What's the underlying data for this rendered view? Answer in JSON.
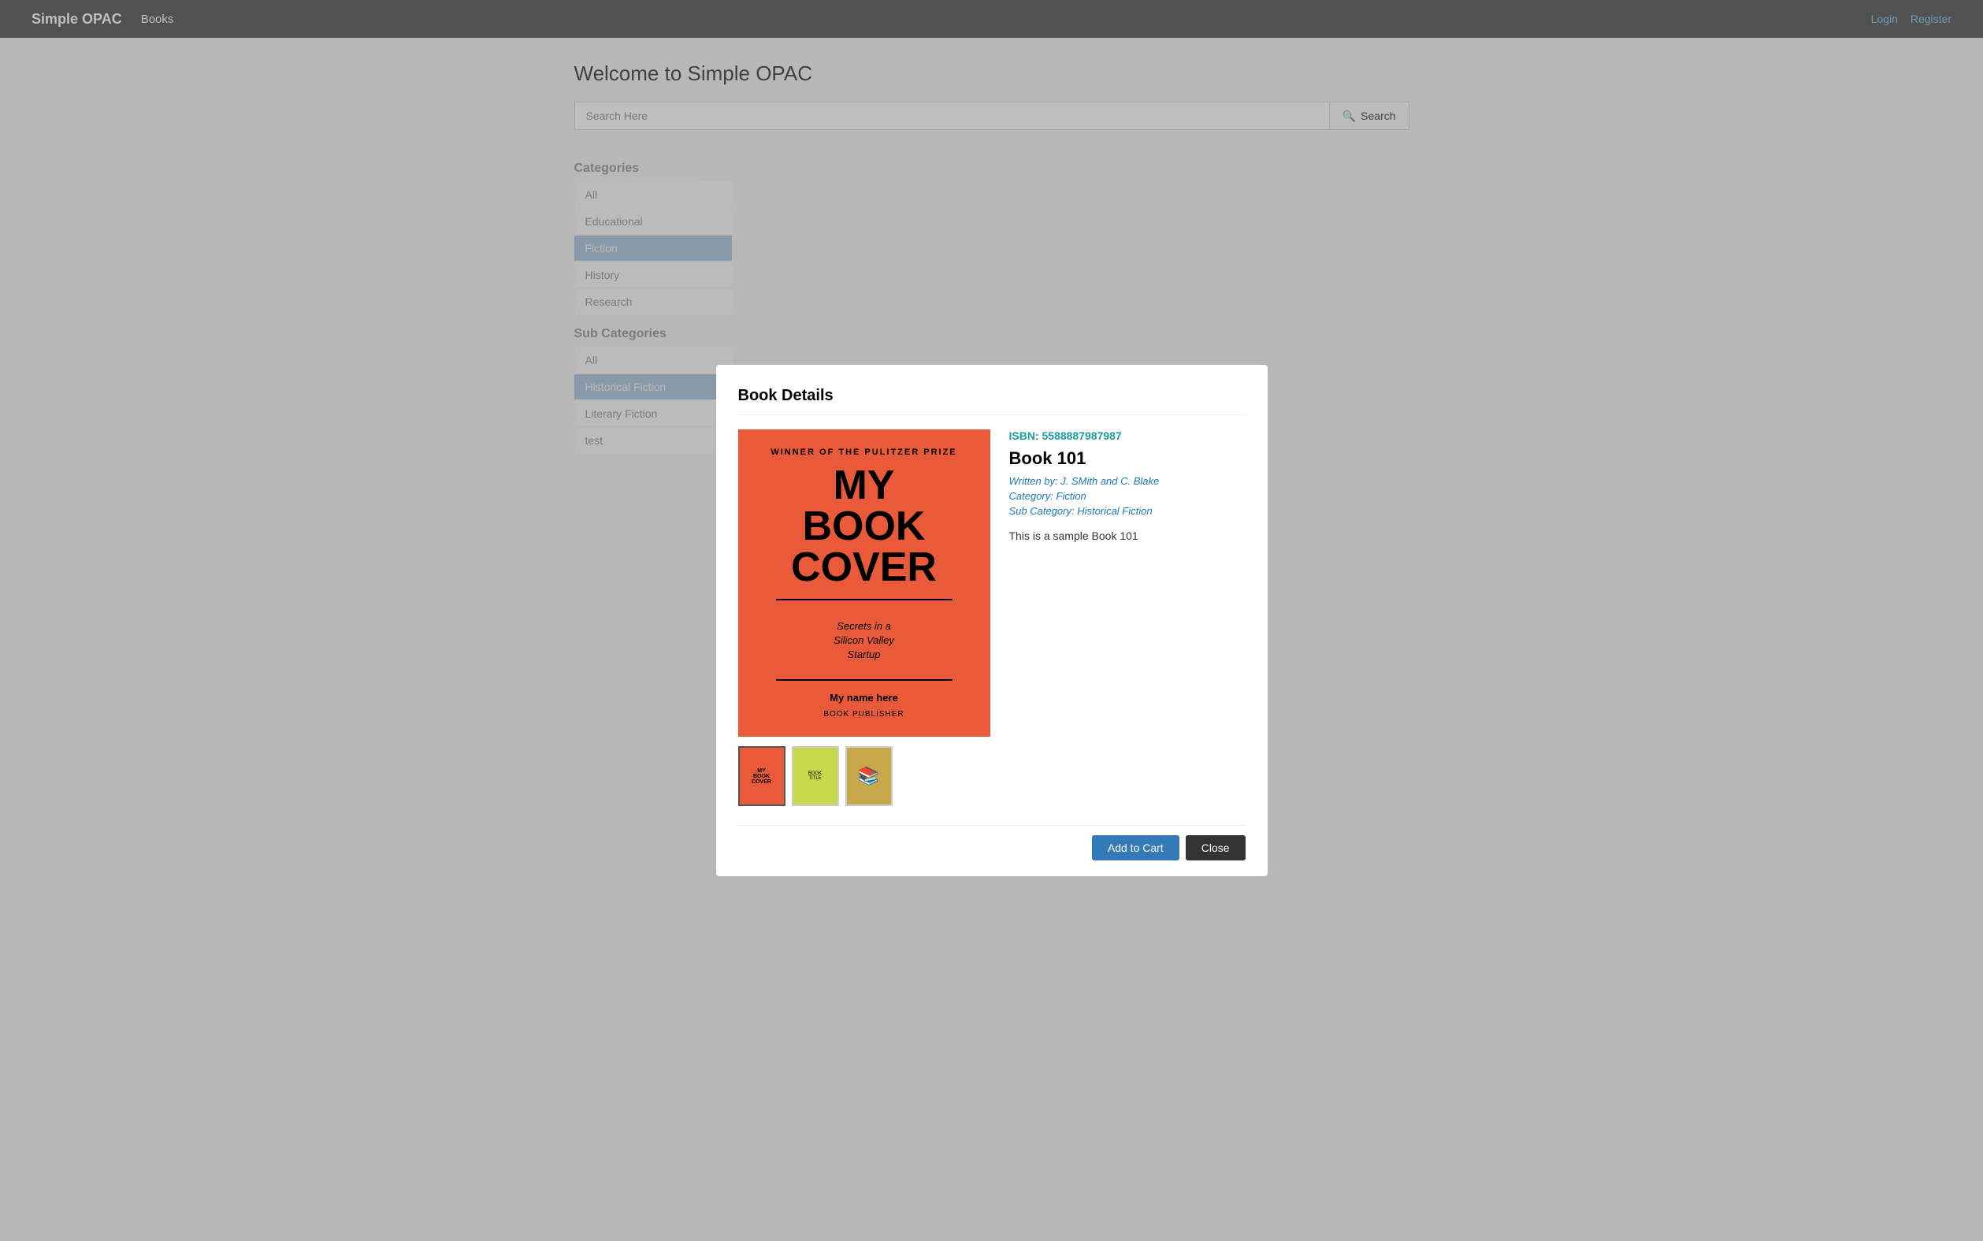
{
  "navbar": {
    "brand": "Simple OPAC",
    "books_link": "Books",
    "login": "Login",
    "register": "Register"
  },
  "page": {
    "title": "Welcome to Simple OPAC",
    "search_placeholder": "Search Here",
    "search_button": "Search"
  },
  "sidebar": {
    "categories_title": "Categories",
    "categories": [
      {
        "label": "All",
        "active": false
      },
      {
        "label": "Educational",
        "active": false
      },
      {
        "label": "Fiction",
        "active": true
      },
      {
        "label": "History",
        "active": false
      },
      {
        "label": "Research",
        "active": false
      }
    ],
    "subcategories_title": "Sub Categories",
    "subcategories": [
      {
        "label": "All",
        "active": false
      },
      {
        "label": "Historical Fiction",
        "active": true
      },
      {
        "label": "Literary Fiction",
        "active": false
      },
      {
        "label": "test",
        "active": false
      }
    ]
  },
  "modal": {
    "title": "Book Details",
    "isbn_label": "ISBN: 5588887987987",
    "book_name": "Book 101",
    "written_by_label": "Written by:",
    "author": "J. SMith and C. Blake",
    "category_label": "Category:",
    "category": "Fiction",
    "subcategory_label": "Sub Category:",
    "subcategory": "Historical Fiction",
    "description": "This is a sample Book 101",
    "add_to_cart": "Add to Cart",
    "close": "Close",
    "cover": {
      "pulitzer": "Winner of the Pulitzer Prize",
      "title_line1": "MY",
      "title_line2": "BOOK",
      "title_line3": "COVER",
      "subtitle": "Secrets in a\nSilicon Valley\nStartup",
      "author": "My name here",
      "publisher": "Book Publisher"
    },
    "thumbnails": [
      {
        "type": "red",
        "label": "MY BOOK COVER"
      },
      {
        "type": "green",
        "label": "BOOK TITLE"
      },
      {
        "type": "books",
        "label": ""
      }
    ]
  }
}
